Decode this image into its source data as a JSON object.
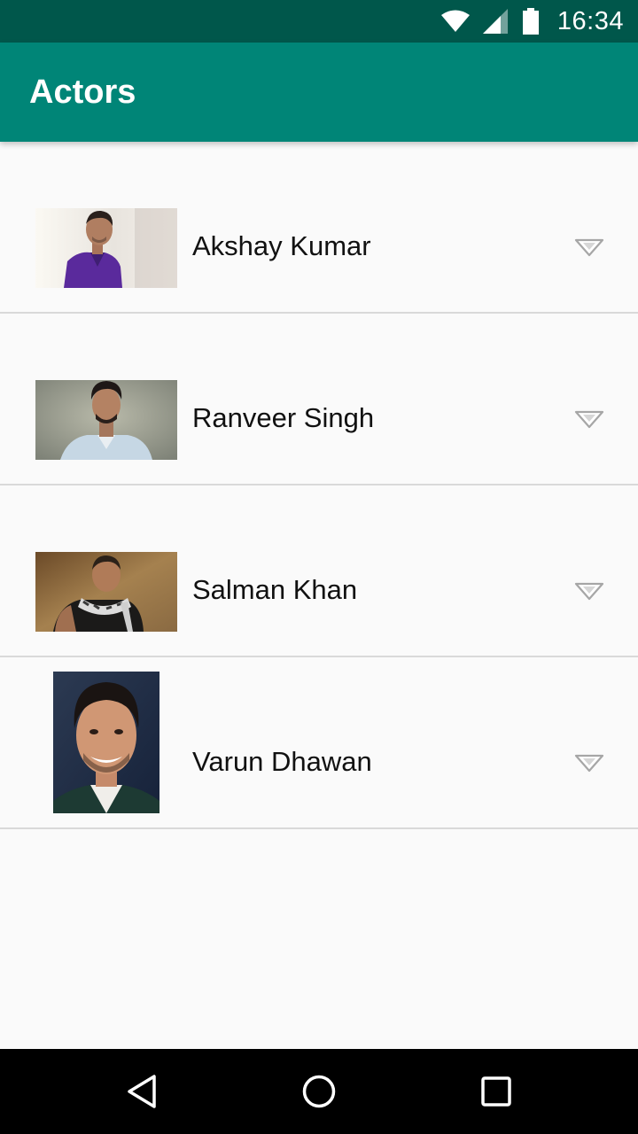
{
  "status_bar": {
    "time": "16:34",
    "icons": [
      "wifi-icon",
      "signal-icon",
      "battery-icon"
    ]
  },
  "app_bar": {
    "title": "Actors",
    "color": "#008577",
    "status_color": "#00574b"
  },
  "actors": [
    {
      "name": "Akshay Kumar",
      "photo": "akshay-kumar-photo",
      "expand_icon": "expand-triangle-icon"
    },
    {
      "name": "Ranveer Singh",
      "photo": "ranveer-singh-photo",
      "expand_icon": "expand-triangle-icon"
    },
    {
      "name": "Salman Khan",
      "photo": "salman-khan-photo",
      "expand_icon": "expand-triangle-icon"
    },
    {
      "name": "Varun Dhawan",
      "photo": "varun-dhawan-photo",
      "expand_icon": "expand-triangle-icon"
    }
  ],
  "nav_bar": {
    "buttons": [
      "back-icon",
      "home-icon",
      "recents-icon"
    ]
  }
}
